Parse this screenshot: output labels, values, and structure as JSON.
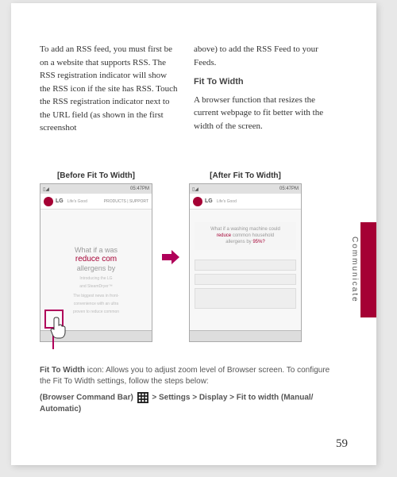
{
  "page_number": "59",
  "side_tab_label": "Communicate",
  "left_col": {
    "p1": "To add an RSS feed, you must first be on a website that supports RSS. The RSS registration indicator will show the RSS icon if the site has RSS. Touch the RSS registration indicator next to the URL field (as shown in the first screenshot"
  },
  "right_col": {
    "p1": "above) to add the RSS Feed to your Feeds.",
    "head": "Fit To Width",
    "p2": "A browser function that resizes the current webpage to fit better with the width of the screen."
  },
  "screenshots": {
    "before_label": "[Before Fit To Width]",
    "after_label": "[After Fit To Width]",
    "time": "05:47PM",
    "brand": "LG",
    "slogan": "Life's Good",
    "tabs": "PRODUCTS | SUPPORT",
    "before_hero_l1": "What if a was",
    "before_hero_l2": "reduce com",
    "before_hero_l3": "allergens by",
    "before_sub_l1": "Introducing the LG",
    "before_sub_l2": "and SteamDryer™",
    "before_sub_l3": "The biggest news in front-",
    "before_sub_l4": "convenience with an ultra",
    "before_sub_l5": "proven to reduce common",
    "after_hero_l1": "What if a washing machine could",
    "after_hero_l2a": "reduce",
    "after_hero_l2b": " common household",
    "after_hero_l3a": "allergens by ",
    "after_hero_l3b": "95%?"
  },
  "footnote": {
    "p1a": "Fit To Width",
    "p1b": " icon: Allows you to adjust zoom level of Browser screen. To configure the Fit To Width settings, follow the steps below:",
    "p2a": "(Browser Command Bar) ",
    "p2b": " > Settings > Display > Fit to width (Manual/ Automatic)"
  }
}
